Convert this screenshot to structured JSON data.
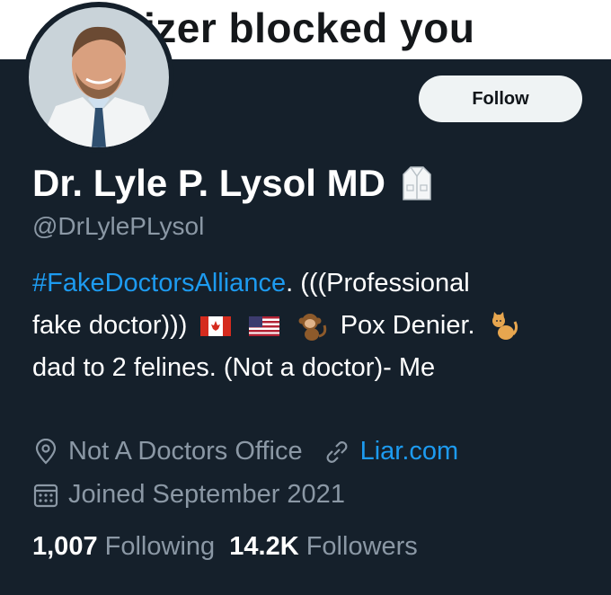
{
  "banner": {
    "text": "izer blocked you"
  },
  "profile": {
    "follow_label": "Follow",
    "display_name": "Dr. Lyle P. Lysol MD",
    "handle": "@DrLylePLysol",
    "bio": {
      "hashtag": "#FakeDoctorsAlliance",
      "line1_rest": ". (((Professional",
      "line2_text": "fake doctor)))",
      "line2_text_b": "Pox Denier.",
      "line3": "dad to 2 felines. (Not a doctor)- Me"
    },
    "location": "Not A Doctors Office",
    "website": "Liar.com",
    "joined": "Joined September 2021",
    "following_count": "1,007",
    "following_label": "Following",
    "followers_count": "14.2K",
    "followers_label": "Followers"
  },
  "icons": {
    "name_badge": "lab-coat-icon",
    "bio_emojis": [
      "canada-flag-icon",
      "us-flag-icon",
      "monkey-icon",
      "cat-icon"
    ],
    "location": "location-pin-icon",
    "website": "link-icon",
    "joined": "calendar-icon"
  },
  "colors": {
    "background": "#15202b",
    "accent": "#1d9bf0",
    "secondary_text": "#8b98a5",
    "button_bg": "#eff3f4"
  }
}
